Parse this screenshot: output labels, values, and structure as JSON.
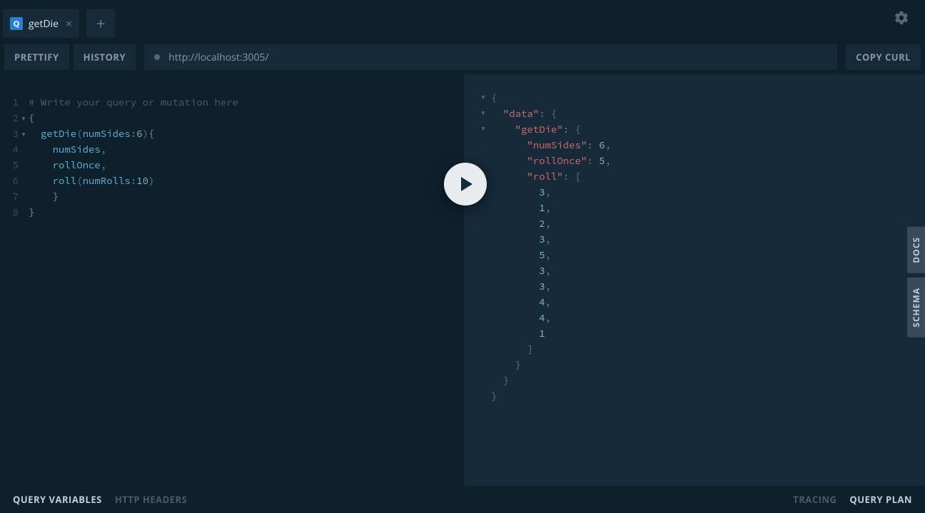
{
  "tab": {
    "badge": "Q",
    "title": "getDie"
  },
  "toolbar": {
    "prettify": "Prettify",
    "history": "History",
    "copy_curl": "Copy CURL",
    "url": "http://localhost:3005/"
  },
  "editor": {
    "comment": "# Write your query or mutation here",
    "lines": [
      "1",
      "2",
      "3",
      "4",
      "5",
      "6",
      "7",
      "8"
    ],
    "query": {
      "field": "getDie",
      "arg1_name": "numSides",
      "arg1_val": "6",
      "f1": "numSides",
      "f2": "rollOnce",
      "f3": "roll",
      "arg2_name": "numRolls",
      "arg2_val": "10"
    }
  },
  "response": {
    "data_key": "\"data\"",
    "getdie_key": "\"getDie\"",
    "numsides_key": "\"numSides\"",
    "numsides_val": "6",
    "rollonce_key": "\"rollOnce\"",
    "rollonce_val": "5",
    "roll_key": "\"roll\"",
    "roll_vals": [
      "3",
      "1",
      "2",
      "3",
      "5",
      "3",
      "3",
      "4",
      "4",
      "1"
    ]
  },
  "side": {
    "docs": "DOCS",
    "schema": "SCHEMA"
  },
  "bottom": {
    "qv": "Query Variables",
    "hh": "HTTP Headers",
    "tracing": "Tracing",
    "qp": "Query Plan"
  }
}
